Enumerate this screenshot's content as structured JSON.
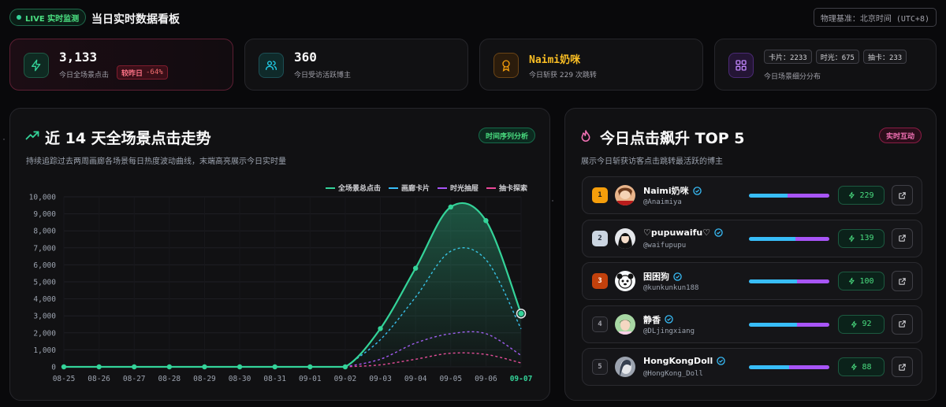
{
  "header": {
    "live_label": "LIVE 实时监测",
    "title": "当日实时数据看板",
    "timezone": "物理基准：北京时间 (UTC+8)"
  },
  "kpis": {
    "total_clicks": {
      "value": "3,133",
      "label": "今日全场景点击",
      "delta_label": "较昨日",
      "delta_value": "-64%"
    },
    "creators": {
      "value": "360",
      "label": "今日受访活跃博主"
    },
    "top_creator": {
      "value": "Naimi奶咪",
      "label": "今日斩获 229 次跳转"
    },
    "breakdown": {
      "chips": [
        "卡片：2233",
        "时光：675",
        "抽卡：233"
      ],
      "label": "今日场景细分分布"
    }
  },
  "trend": {
    "title": "近 14 天全场景点击走势",
    "tag": "时间序列分析",
    "subtitle": "持续追踪过去两周画廊各场景每日热度波动曲线，末端高亮展示今日实时量"
  },
  "top5": {
    "title": "今日点击飙升 TOP 5",
    "tag": "实时互动",
    "subtitle": "展示今日斩获访客点击跳转最活跃的博主",
    "items": [
      {
        "rank": "1",
        "name": "Naimi奶咪",
        "handle": "@Anaimiya",
        "score": "229",
        "split": 0.48
      },
      {
        "rank": "2",
        "name": "♡pupuwaifu♡",
        "handle": "@waifupupu",
        "score": "139",
        "split": 0.58
      },
      {
        "rank": "3",
        "name": "困困狗",
        "handle": "@kunkunkun188",
        "score": "100",
        "split": 0.6
      },
      {
        "rank": "4",
        "name": "静香",
        "handle": "@DLjingxiang",
        "score": "92",
        "split": 0.6
      },
      {
        "rank": "5",
        "name": "HongKongDoll",
        "handle": "@HongKong_Doll",
        "score": "88",
        "split": 0.5
      }
    ]
  },
  "colors": {
    "total": "#34d399",
    "card": "#38bdf8",
    "time": "#a855f7",
    "gacha": "#ec4899"
  },
  "chart_data": {
    "type": "line",
    "categories": [
      "08-25",
      "08-26",
      "08-27",
      "08-28",
      "08-29",
      "08-30",
      "08-31",
      "09-01",
      "09-02",
      "09-03",
      "09-04",
      "09-05",
      "09-06",
      "09-07"
    ],
    "ylim": [
      0,
      10000
    ],
    "yticks": [
      "0",
      "1,000",
      "2,000",
      "3,000",
      "4,000",
      "5,000",
      "6,000",
      "7,000",
      "8,000",
      "9,000",
      "10,000"
    ],
    "legend_position": "top-right",
    "series": [
      {
        "name": "全场景总点击",
        "values": [
          0,
          0,
          0,
          0,
          0,
          0,
          0,
          0,
          0,
          2250,
          5800,
          9400,
          8600,
          3133
        ]
      },
      {
        "name": "画廊卡片",
        "values": [
          0,
          0,
          0,
          0,
          0,
          0,
          0,
          0,
          0,
          1600,
          4100,
          6800,
          6300,
          2233
        ]
      },
      {
        "name": "时光抽屉",
        "values": [
          0,
          0,
          0,
          0,
          0,
          0,
          0,
          0,
          0,
          450,
          1400,
          1950,
          1950,
          675
        ]
      },
      {
        "name": "抽卡探索",
        "values": [
          0,
          0,
          0,
          0,
          0,
          0,
          0,
          0,
          0,
          120,
          450,
          800,
          730,
          233
        ]
      }
    ]
  }
}
